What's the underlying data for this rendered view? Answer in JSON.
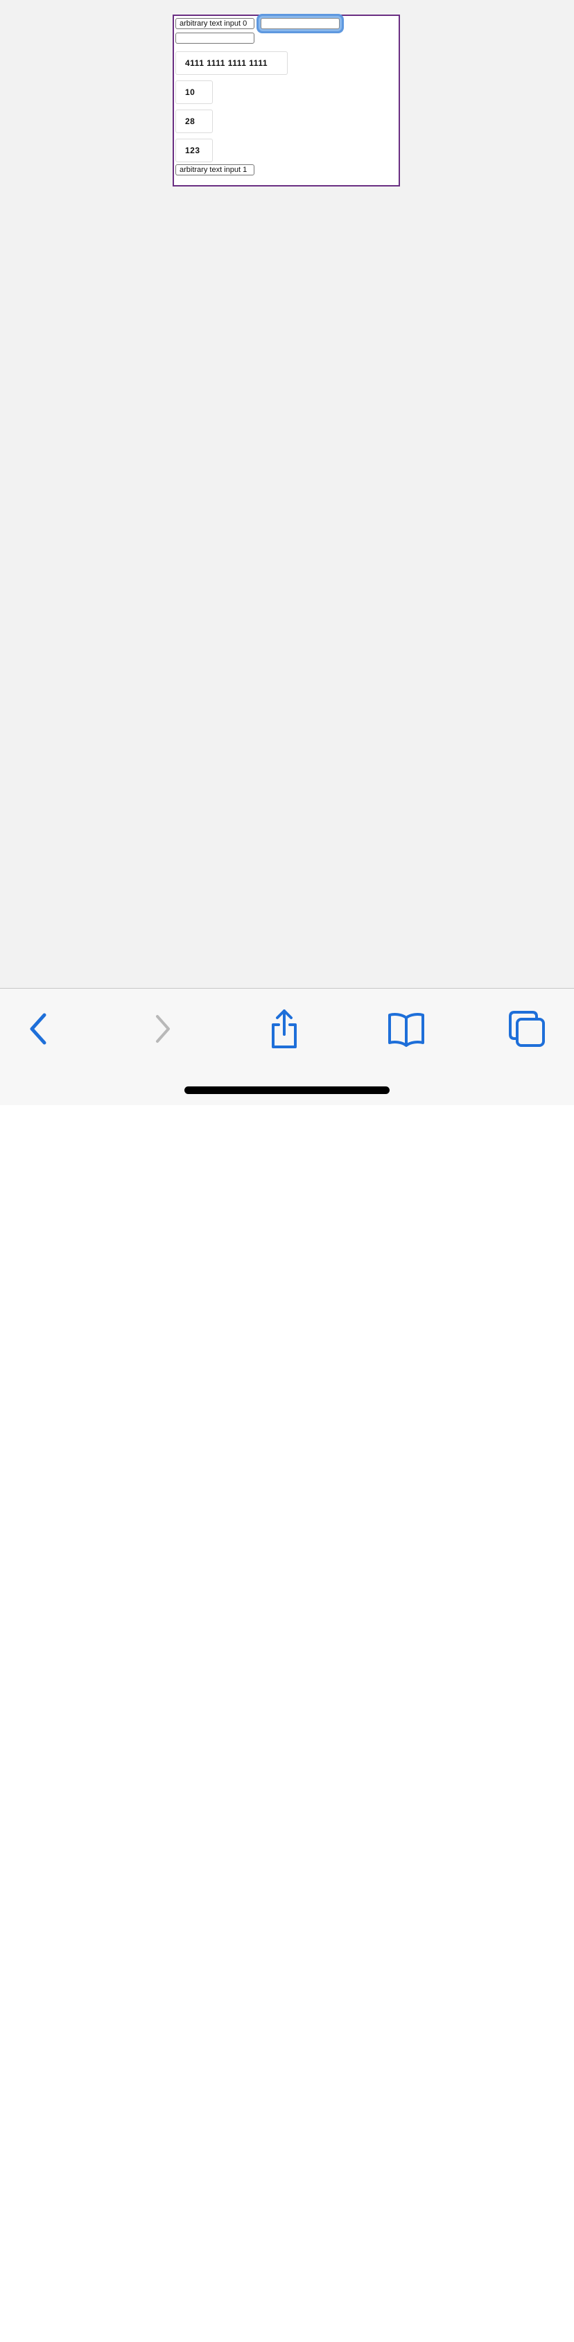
{
  "form": {
    "text_input_0": "arbitrary text input 0",
    "focused_input": "",
    "empty_input": "",
    "card_number": "4111 1111 1111 1111",
    "expiry_month": "10",
    "expiry_year": "28",
    "cvv": "123",
    "text_input_1": "arbitrary text input 1"
  },
  "toolbar": {
    "accent_color": "#1e6fd9",
    "disabled_color": "#b8b8b8",
    "buttons": [
      {
        "icon": "chevron-left-icon",
        "enabled": true
      },
      {
        "icon": "chevron-right-icon",
        "enabled": false
      },
      {
        "icon": "share-icon",
        "enabled": true
      },
      {
        "icon": "book-icon",
        "enabled": true
      },
      {
        "icon": "tabs-icon",
        "enabled": true
      }
    ]
  }
}
